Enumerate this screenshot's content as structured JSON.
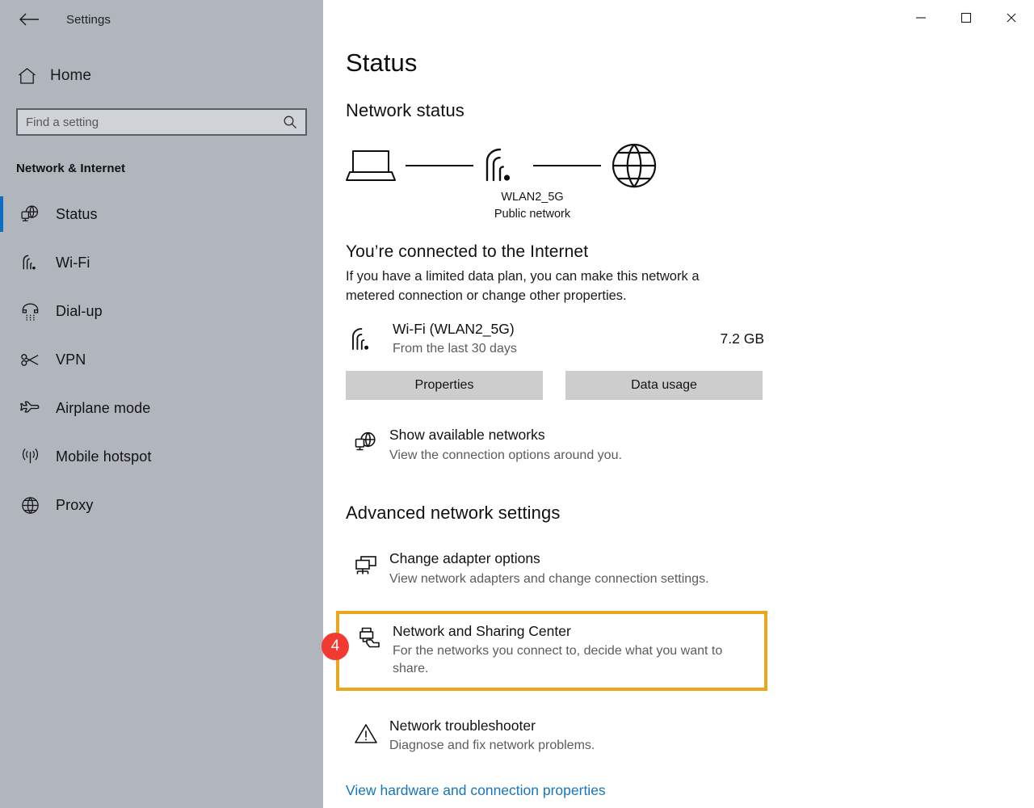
{
  "window": {
    "titlebar_title": "Settings",
    "back_icon": "back-arrow-icon",
    "controls": {
      "minimize": "minimize-icon",
      "maximize": "maximize-icon",
      "close": "close-icon"
    }
  },
  "sidebar": {
    "home_label": "Home",
    "home_icon": "home-icon",
    "search": {
      "placeholder": "Find a setting",
      "value": "",
      "icon": "search-icon"
    },
    "category": "Network & Internet",
    "selected_index": 0,
    "items": [
      {
        "label": "Status",
        "icon": "network-status-icon",
        "selected": true
      },
      {
        "label": "Wi-Fi",
        "icon": "wifi-icon",
        "selected": false
      },
      {
        "label": "Dial-up",
        "icon": "dialup-phone-icon",
        "selected": false
      },
      {
        "label": "VPN",
        "icon": "vpn-key-icon",
        "selected": false
      },
      {
        "label": "Airplane mode",
        "icon": "airplane-icon",
        "selected": false
      },
      {
        "label": "Mobile hotspot",
        "icon": "hotspot-icon",
        "selected": false
      },
      {
        "label": "Proxy",
        "icon": "globe-icon",
        "selected": false
      }
    ]
  },
  "main": {
    "page_title": "Status",
    "network_status_heading": "Network status",
    "diagram": {
      "device_icon": "laptop-icon",
      "link_icon": "wifi-signal-icon",
      "internet_icon": "globe-icon",
      "network_name": "WLAN2_5G",
      "network_type": "Public network"
    },
    "connection_lead": "You’re connected to the Internet",
    "connection_body": "If you have a limited data plan, you can make this network a metered connection or change other properties.",
    "usage": {
      "icon": "wifi-signal-icon",
      "title": "Wi-Fi (WLAN2_5G)",
      "subtitle": "From the last 30 days",
      "amount": "7.2 GB"
    },
    "buttons": {
      "properties": "Properties",
      "data_usage": "Data usage"
    },
    "show_networks": {
      "icon": "network-globe-icon",
      "title": "Show available networks",
      "subtitle": "View the connection options around you."
    },
    "advanced_heading": "Advanced network settings",
    "advanced_items": [
      {
        "icon": "adapter-monitors-icon",
        "title": "Change adapter options",
        "subtitle": "View network adapters and change connection settings.",
        "highlighted": false
      },
      {
        "icon": "sharing-center-icon",
        "title": "Network and Sharing Center",
        "subtitle": "For the networks you connect to, decide what you want to share.",
        "highlighted": true
      },
      {
        "icon": "warning-triangle-icon",
        "title": "Network troubleshooter",
        "subtitle": "Diagnose and fix network problems.",
        "highlighted": false
      }
    ],
    "bottom_link": "View hardware and connection properties"
  },
  "annotation": {
    "step_badge": "4",
    "badge_color": "#f23a33",
    "highlight_color": "#e9a81c"
  },
  "colors": {
    "sidebar_bg": "#b1b6bd",
    "accent_blue": "#0b6ec4",
    "link_blue": "#1576bb",
    "button_bg": "#cdcdcd"
  }
}
